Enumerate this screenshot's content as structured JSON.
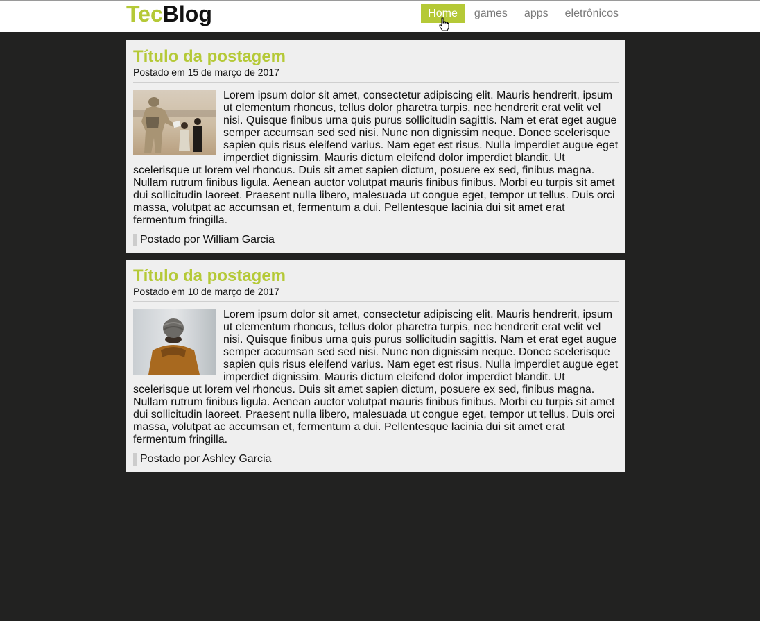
{
  "header": {
    "logo_part1": "Tec",
    "logo_part2": "Blog",
    "nav": [
      {
        "label": "Home"
      },
      {
        "label": "games"
      },
      {
        "label": "apps"
      },
      {
        "label": "eletrônicos"
      }
    ],
    "active_nav": "Home"
  },
  "colors": {
    "accent": "#b5c937",
    "page_bg": "#222221",
    "post_bg": "#efefef"
  },
  "posts": [
    {
      "title": "Título da postagem",
      "date": "Postado em 15 de março de 2017",
      "image": "soldier-child-photo",
      "body": "Lorem ipsum dolor sit amet, consectetur adipiscing elit. Mauris hendrerit, ipsum ut elementum rhoncus, tellus dolor pharetra turpis, nec hendrerit erat velit vel nisi. Quisque finibus urna quis purus sollicitudin sagittis. Nam et erat eget augue semper accumsan sed sed nisi. Nunc non dignissim neque. Donec scelerisque sapien quis risus eleifend varius. Nam eget est risus. Nulla imperdiet augue eget imperdiet dignissim. Mauris dictum eleifend dolor imperdiet blandit. Ut scelerisque ut lorem vel rhoncus. Duis sit amet sapien dictum, posuere ex sed, finibus magna. Nullam rutrum finibus ligula. Aenean auctor volutpat mauris finibus finibus. Morbi eu turpis sit amet dui sollicitudin laoreet. Praesent nulla libero, malesuada ut congue eget, tempor ut tellus. Duis orci massa, volutpat ac accumsan et, fermentum a dui. Pellentesque lacinia dui sit amet erat fermentum fringilla.",
      "author": "Postado por William Garcia"
    },
    {
      "title": "Título da postagem",
      "date": "Postado em 10 de março de 2017",
      "image": "person-beanie-photo",
      "body": "Lorem ipsum dolor sit amet, consectetur adipiscing elit. Mauris hendrerit, ipsum ut elementum rhoncus, tellus dolor pharetra turpis, nec hendrerit erat velit vel nisi. Quisque finibus urna quis purus sollicitudin sagittis. Nam et erat eget augue semper accumsan sed sed nisi. Nunc non dignissim neque. Donec scelerisque sapien quis risus eleifend varius. Nam eget est risus. Nulla imperdiet augue eget imperdiet dignissim. Mauris dictum eleifend dolor imperdiet blandit. Ut scelerisque ut lorem vel rhoncus. Duis sit amet sapien dictum, posuere ex sed, finibus magna. Nullam rutrum finibus ligula. Aenean auctor volutpat mauris finibus finibus. Morbi eu turpis sit amet dui sollicitudin laoreet. Praesent nulla libero, malesuada ut congue eget, tempor ut tellus. Duis orci massa, volutpat ac accumsan et, fermentum a dui. Pellentesque lacinia dui sit amet erat fermentum fringilla.",
      "author": "Postado por Ashley Garcia"
    }
  ]
}
